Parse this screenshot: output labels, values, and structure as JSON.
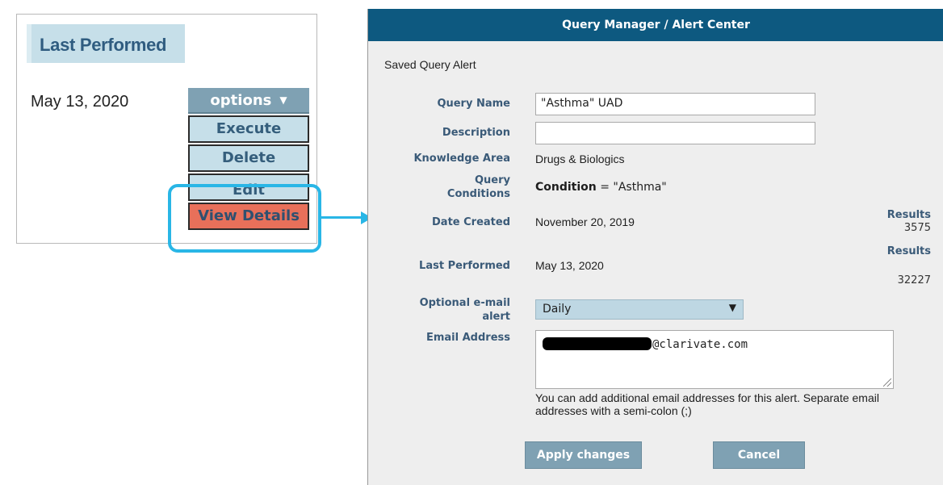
{
  "left_panel": {
    "heading": "Last Performed",
    "date": "May 13, 2020",
    "options_label": "options",
    "menu": {
      "execute": "Execute",
      "delete": "Delete",
      "edit": "Edit",
      "view_details": "View Details"
    }
  },
  "dialog": {
    "title": "Query Manager / Alert Center",
    "subtitle": "Saved Query Alert",
    "labels": {
      "query_name": "Query Name",
      "description": "Description",
      "knowledge_area": "Knowledge Area",
      "query_conditions": "Query Conditions",
      "date_created": "Date Created",
      "last_performed": "Last Performed",
      "optional_email_alert": "Optional e-mail alert",
      "email_address": "Email Address"
    },
    "values": {
      "query_name": "\"Asthma\" UAD",
      "description": "",
      "knowledge_area": "Drugs & Biologics",
      "condition_key": "Condition",
      "condition_rest": " = \"Asthma\"",
      "date_created": "November 20, 2019",
      "last_performed": "May 13, 2020",
      "email_alert": "Daily",
      "email_suffix": "@clarivate.com"
    },
    "results_created": {
      "label": "Results",
      "value": "3575"
    },
    "results_performed": {
      "label": "Results",
      "value": "32227"
    },
    "help_text": "You can add additional email addresses for this alert. Separate email addresses with a semi-colon (;)",
    "buttons": {
      "apply": "Apply changes",
      "cancel": "Cancel"
    }
  },
  "colors": {
    "header_bg": "#0d5980",
    "highlight": "#29b6e6",
    "view_details_bg": "#e8705a",
    "button_bg": "#7fa1b3"
  }
}
